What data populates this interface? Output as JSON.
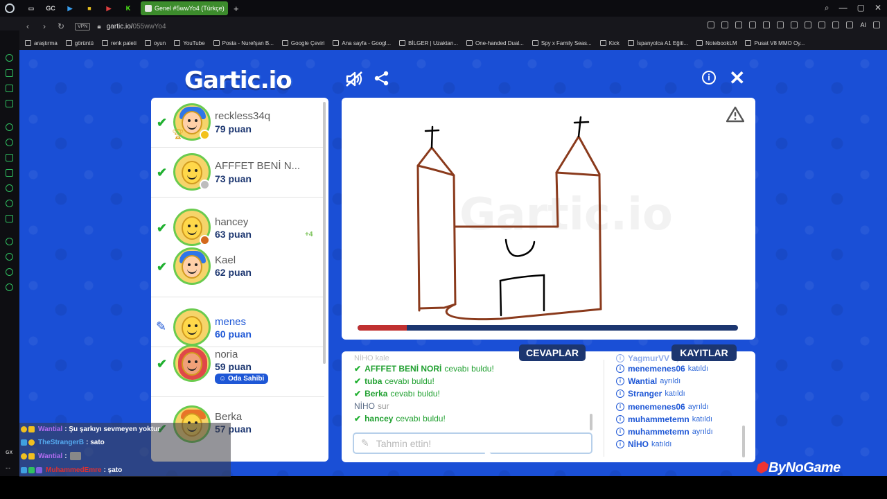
{
  "browser": {
    "tab_title": "Genel #5wwYo4 (Türkçe)",
    "tab_shortcuts": [
      "GC"
    ],
    "url_host": "gartic.io/",
    "url_path": "055wwYo4",
    "vpn_label": "VPN",
    "ai_label": "AI",
    "sidebar_gx": "GX",
    "bookmarks": [
      "araştırma",
      "görüntü",
      "renk paleti",
      "oyun",
      "YouTube",
      "Posta - Nurefşan B...",
      "Google Çeviri",
      "Ana sayfa - Googl...",
      "BİLGER | Uzaktan...",
      "One-handed Dual...",
      "Spy x Family Seas...",
      "Kick",
      "İspanyolca A1 Eğiti...",
      "NotebookLM",
      "Pusat V8 MMO Oy..."
    ]
  },
  "game": {
    "logo_text": "Gartic.io",
    "players": [
      {
        "name": "reckless34q",
        "score": "79 puan",
        "status": "guessed",
        "badge_color": "#f2c21b",
        "trophy": true
      },
      {
        "name": "AFFFET BENİ N...",
        "score": "73 puan",
        "status": "guessed",
        "badge_color": "#bdbdbd"
      },
      {
        "name": "hancey",
        "score": "63 puan",
        "status": "guessed",
        "badge_color": "#d4691c",
        "plus": "+4"
      },
      {
        "name": "Kael",
        "score": "62 puan",
        "status": "guessed"
      },
      {
        "name": "menes",
        "score": "60 puan",
        "status": "drawing"
      },
      {
        "name": "noria",
        "score": "59 puan",
        "status": "guessed",
        "owner_label": "Oda Sahibi"
      },
      {
        "name": "Berka",
        "score": "57 puan",
        "status": "guessed"
      }
    ],
    "progress_fraction": 0.13,
    "tabs": {
      "answers": "CEVAPLAR",
      "logs": "KAYITLAR"
    },
    "answers": [
      {
        "user": "NİHO",
        "text": "kale",
        "type": "faded"
      },
      {
        "user": "AFFFET BENİ NORİ",
        "text": "cevabı buldu!",
        "type": "found"
      },
      {
        "user": "tuba",
        "text": "cevabı buldu!",
        "type": "found"
      },
      {
        "user": "Berka",
        "text": "cevabı buldu!",
        "type": "found"
      },
      {
        "user": "NİHO",
        "text": "sur",
        "type": "plain"
      },
      {
        "user": "hancey",
        "text": "cevabı buldu!",
        "type": "found"
      }
    ],
    "guess_placeholder": "Tahmin ettin!",
    "logs": [
      {
        "user": "YagmurVV",
        "action": "ayrıldı"
      },
      {
        "user": "menemenes06",
        "action": "katıldı"
      },
      {
        "user": "Wantial",
        "action": "ayrıldı"
      },
      {
        "user": "Stranger",
        "action": "katıldı"
      },
      {
        "user": "menemenes06",
        "action": "ayrıldı"
      },
      {
        "user": "muhammetemn",
        "action": "katıldı"
      },
      {
        "user": "muhammetemn",
        "action": "ayrıldı"
      },
      {
        "user": "NİHO",
        "action": "katıldı"
      }
    ],
    "sponsor": "ByNoGame"
  },
  "stream_chat": [
    {
      "user": "Wantial",
      "user_color": "#b06cf0",
      "message": ": Şu şarkıyı sevmeyen yoktur"
    },
    {
      "user": "TheStrangerB",
      "user_color": "#55aaf0",
      "message": ": sato"
    },
    {
      "user": "Wantial",
      "user_color": "#b06cf0",
      "message": ":"
    },
    {
      "user": "MuhammedEmre",
      "user_color": "#e03030",
      "message": ": şato"
    }
  ]
}
